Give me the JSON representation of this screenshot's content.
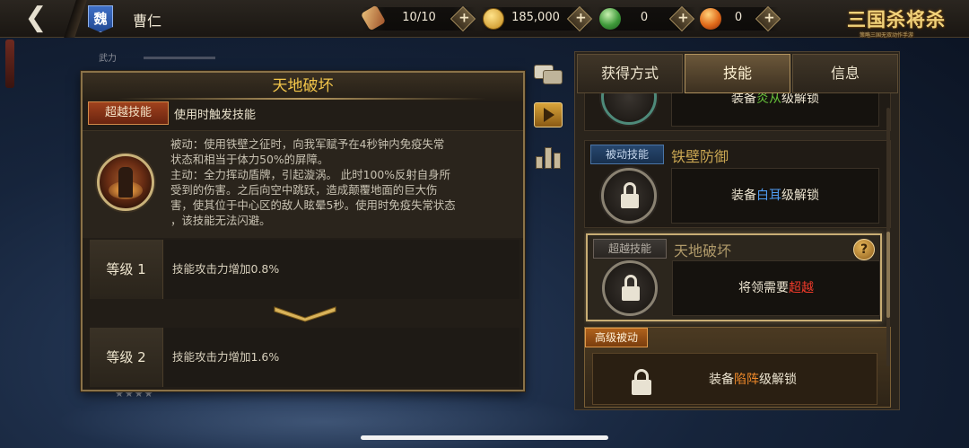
{
  "topbar": {
    "back_label": "❮",
    "faction": "魏",
    "general_name": "曹仁",
    "stamina": "10/10",
    "gold": "185,000",
    "jade": "0",
    "ingot": "0",
    "plus_label": "+",
    "logo_title": "三国杀将杀",
    "logo_subtitle": "策略三国无双动作手游"
  },
  "background": {
    "stat_label": "武力",
    "stars": "★★★★"
  },
  "detail": {
    "title": "天地破坏",
    "type_tag": "超越技能",
    "trigger": "使用时触发技能",
    "description_lines": [
      "被动：使用铁壁之征时，向我军赋予在4秒钟内免疫失常",
      "状态和相当于体力50%的屏障。",
      "主动：全力挥动盾牌，引起漩涡。 此时100%反射自身所",
      "受到的伤害。之后向空中跳跃，造成颠覆地面的巨大伤",
      "害，使其位于中心区的敌人眩晕5秒。使用时免疫失常状态",
      "，该技能无法闪避。"
    ],
    "levels": [
      {
        "label": "等级 1",
        "effect": "技能攻击力增加0.8%"
      },
      {
        "label": "等级 2",
        "effect": "技能攻击力增加1.6%"
      }
    ]
  },
  "tabs": [
    "获得方式",
    "技能",
    "信息"
  ],
  "skills": {
    "partial_top": {
      "prefix": "装备",
      "hl": "炎从",
      "suffix": "级解锁"
    },
    "passive": {
      "tag": "被动技能",
      "name": "铁壁防御",
      "prefix": "装备",
      "hl": "白耳",
      "suffix": "级解锁"
    },
    "transcend": {
      "tag": "超越技能",
      "name": "天地破坏",
      "help": "?",
      "prefix": "将领需要",
      "hl": "超越"
    },
    "advanced": {
      "tag": "高级被动",
      "prefix": "装备",
      "hl": "陷阵",
      "suffix": "级解锁"
    }
  },
  "colors": {
    "title_gold": "#f3c64a",
    "highlight_blue": "#4f9bf0",
    "highlight_red": "#f03a2a",
    "highlight_orange": "#f08a2a"
  }
}
